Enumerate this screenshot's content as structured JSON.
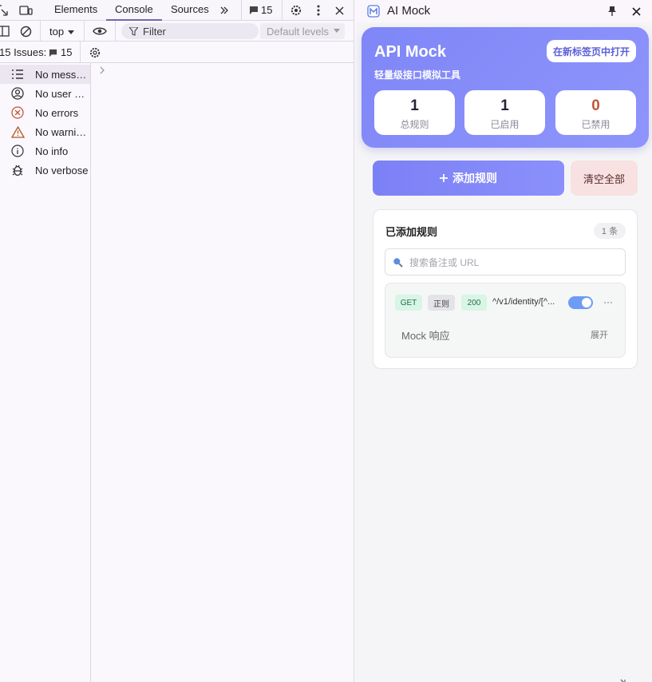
{
  "devtools": {
    "tabs": [
      "Elements",
      "Console",
      "Sources"
    ],
    "active_tab": "Console",
    "issues_badge_count": "15",
    "context": "top",
    "filter_placeholder": "Filter",
    "levels_label": "Default levels",
    "issues_label": "15 Issues:",
    "issues_count": "15",
    "sidebar": [
      {
        "label": "No messages",
        "icon": "list-icon"
      },
      {
        "label": "No user messages",
        "icon": "user-icon"
      },
      {
        "label": "No errors",
        "icon": "error-icon"
      },
      {
        "label": "No warnings",
        "icon": "warning-icon"
      },
      {
        "label": "No info",
        "icon": "info-icon"
      },
      {
        "label": "No verbose",
        "icon": "bug-icon"
      }
    ]
  },
  "extension": {
    "title": "AI Mock",
    "hero": {
      "title": "API Mock",
      "subtitle": "轻量级接口模拟工具",
      "open_tab_label": "在新标签页中打开"
    },
    "stats": [
      {
        "value": "1",
        "label": "总规则",
        "color": "#23233a"
      },
      {
        "value": "1",
        "label": "已启用",
        "color": "#23233a"
      },
      {
        "value": "0",
        "label": "已禁用",
        "color": "#c0583a"
      }
    ],
    "add_rule_label": "添加规则",
    "clear_all_label": "清空全部",
    "rules_title": "已添加规则",
    "rules_count": "1 条",
    "search_placeholder": "搜索备注或 URL",
    "rules": [
      {
        "method": "GET",
        "match": "正则",
        "status": "200",
        "url": "^/v1/identity/[^...",
        "enabled": true,
        "more": "···",
        "mock_label": "Mock 响应",
        "expand_label": "展开"
      }
    ],
    "colors": {
      "accent": "#7f86f7",
      "danger_bg": "#f7e1e1",
      "toggle_on": "#6e9bf5"
    }
  }
}
